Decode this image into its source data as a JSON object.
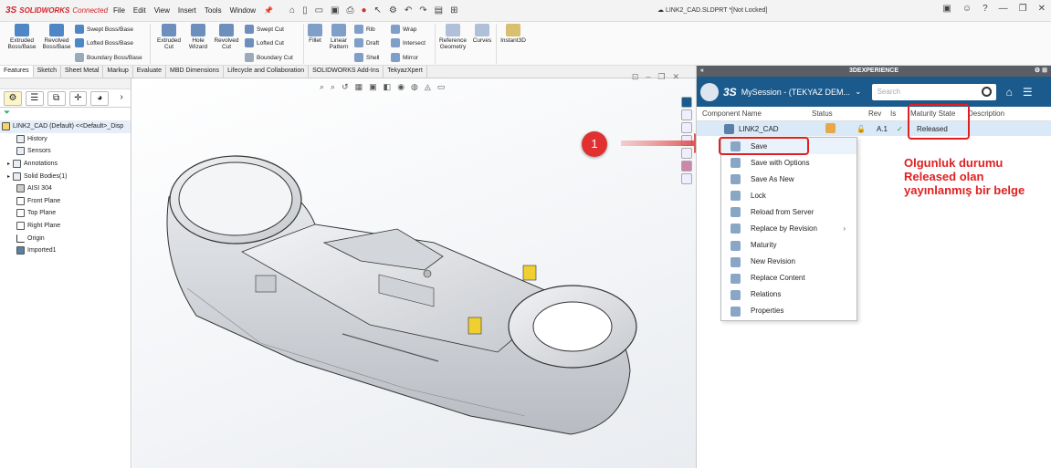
{
  "app": {
    "brand_ds": "3S",
    "brand_name": "SOLIDWORKS",
    "brand_suffix": "Connected"
  },
  "menu": [
    "File",
    "Edit",
    "View",
    "Insert",
    "Tools",
    "Window"
  ],
  "document_title": "LINK2_CAD.SLDPRT *[Not Locked]",
  "ribbon": {
    "extruded_boss": "Extruded Boss/Base",
    "revolved_boss": "Revolved Boss/Base",
    "swept_boss": "Swept Boss/Base",
    "lofted_boss": "Lofted Boss/Base",
    "boundary_boss": "Boundary Boss/Base",
    "extruded_cut": "Extruded Cut",
    "hole_wizard": "Hole Wizard",
    "revolved_cut": "Revolved Cut",
    "swept_cut": "Swept Cut",
    "lofted_cut": "Lofted Cut",
    "boundary_cut": "Boundary Cut",
    "fillet": "Fillet",
    "linear_pattern": "Linear Pattern",
    "rib": "Rib",
    "draft": "Draft",
    "shell": "Shell",
    "wrap": "Wrap",
    "intersect": "Intersect",
    "mirror": "Mirror",
    "reference_geometry": "Reference Geometry",
    "curves": "Curves",
    "instant3d": "Instant3D"
  },
  "tabs": [
    "Features",
    "Sketch",
    "Sheet Metal",
    "Markup",
    "Evaluate",
    "MBD Dimensions",
    "Lifecycle and Collaboration",
    "SOLIDWORKS Add-Ins",
    "TekyazXpert"
  ],
  "tree": [
    "LINK2_CAD (Default) <<Default>_Disp",
    "History",
    "Sensors",
    "Annotations",
    "Solid Bodies(1)",
    "AISI 304",
    "Front Plane",
    "Top Plane",
    "Right Plane",
    "Origin",
    "Imported1"
  ],
  "panel": {
    "title": "3DEXPERIENCE",
    "session_ds": "3S",
    "session_name": "MySession - (TEKYAZ DEM...",
    "search_placeholder": "Search",
    "columns": {
      "component": "Component Name",
      "status": "Status",
      "rev": "Rev",
      "is": "Is",
      "maturity": "Maturity State",
      "description": "Description"
    },
    "row": {
      "name": "LINK2_CAD",
      "rev": "A.1",
      "maturity": "Released"
    }
  },
  "context_menu": [
    "Save",
    "Save with Options",
    "Save As New",
    "Lock",
    "Reload from Server",
    "Replace by Revision",
    "Maturity",
    "New Revision",
    "Replace Content",
    "Relations",
    "Properties"
  ],
  "annotation": {
    "badge": "1",
    "note_line1": "Olgunluk durumu",
    "note_line2": "Released olan",
    "note_line3": "yayınlanmış bir belge"
  },
  "colors": {
    "accent_red": "#e02020",
    "session_blue": "#1b5a8c",
    "brand_red": "#d2232a"
  }
}
